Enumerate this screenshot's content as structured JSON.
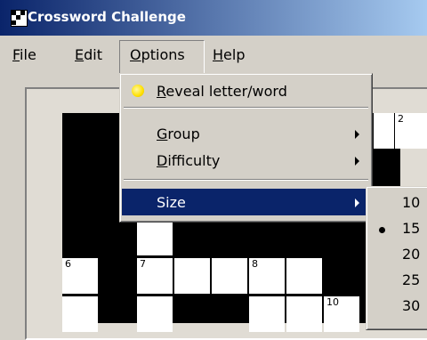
{
  "window": {
    "title": "Crossword Challenge",
    "icon": "crossword-grid-icon"
  },
  "menubar": {
    "items": [
      {
        "label_ul": "F",
        "label_rest": "ile"
      },
      {
        "label_ul": "E",
        "label_rest": "dit"
      },
      {
        "label_ul": "O",
        "label_rest": "ptions"
      },
      {
        "label_ul": "H",
        "label_rest": "elp"
      }
    ]
  },
  "options_menu": {
    "items": [
      {
        "ul": "R",
        "rest": "eveal letter/word",
        "icon": "lightbulb-icon"
      },
      {
        "ul": "G",
        "rest": "roup",
        "submenu": true
      },
      {
        "ul": "D",
        "rest": "ifficulty",
        "submenu": true
      },
      {
        "label": "Size",
        "submenu": true,
        "selected": true
      }
    ]
  },
  "size_submenu": {
    "options": [
      "10",
      "15",
      "20",
      "25",
      "30"
    ],
    "checked": "15"
  },
  "grid": {
    "numbers": [
      "2",
      "6",
      "7",
      "8",
      "10"
    ]
  }
}
